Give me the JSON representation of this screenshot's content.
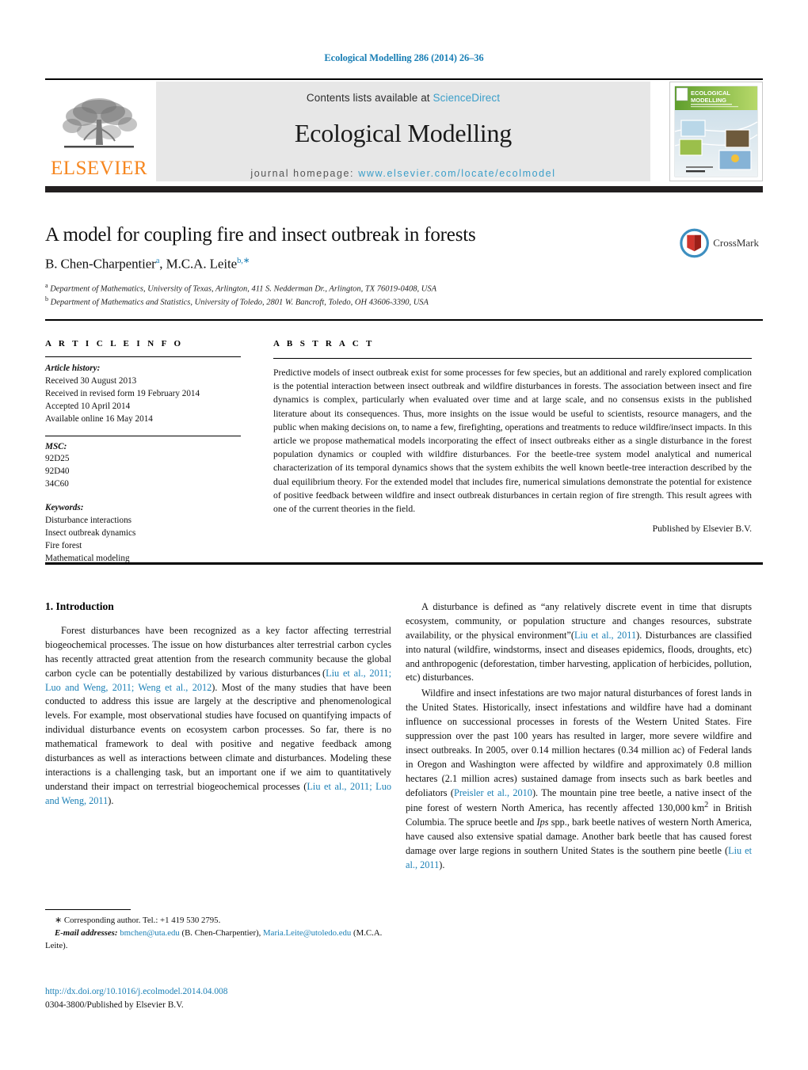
{
  "running_head": "Ecological Modelling 286 (2014) 26–36",
  "header": {
    "contents_prefix": "Contents lists available at ",
    "sciencedirect": "ScienceDirect",
    "journal_title": "Ecological Modelling",
    "homepage_prefix": "journal homepage: ",
    "homepage_url": "www.elsevier.com/locate/ecolmodel",
    "publisher_logo_text": "ELSEVIER",
    "cover_title_line1": "ECOLOGICAL",
    "cover_title_line2": "MODELLING",
    "accent_blue": "#1a7fb5",
    "elsevier_orange": "#F6861F",
    "band_gray": "#e7e7e7"
  },
  "crossmark": {
    "label": "CrossMark"
  },
  "article": {
    "title": "A model for coupling fire and insect outbreak in forests",
    "authors_html": "B. Chen-Charpentier<sup>a</sup>, M.C.A. Leite<sup>b,∗</sup>",
    "affiliation_a": "Department of Mathematics, University of Texas, Arlington, 411 S. Nedderman Dr., Arlington, TX 76019-0408, USA",
    "affiliation_b": "Department of Mathematics and Statistics, University of Toledo, 2801 W. Bancroft, Toledo, OH 43606-3390, USA"
  },
  "info": {
    "heading": "A R T I C L E   I N F O",
    "history_label": "Article history:",
    "history": [
      "Received 30 August 2013",
      "Received in revised form 19 February 2014",
      "Accepted 10 April 2014",
      "Available online 16 May 2014"
    ],
    "msc_label": "MSC:",
    "msc": [
      "92D25",
      "92D40",
      "34C60"
    ],
    "keywords_label": "Keywords:",
    "keywords": [
      "Disturbance interactions",
      "Insect outbreak dynamics",
      "Fire forest",
      "Mathematical modeling"
    ]
  },
  "abstract": {
    "heading": "A B S T R A C T",
    "text": "Predictive models of insect outbreak exist for some processes for few species, but an additional and rarely explored complication is the potential interaction between insect outbreak and wildfire disturbances in forests. The association between insect and fire dynamics is complex, particularly when evaluated over time and at large scale, and no consensus exists in the published literature about its consequences. Thus, more insights on the issue would be useful to scientists, resource managers, and the public when making decisions on, to name a few, firefighting, operations and treatments to reduce wildfire/insect impacts. In this article we propose mathematical models incorporating the effect of insect outbreaks either as a single disturbance in the forest population dynamics or coupled with wildfire disturbances. For the beetle-tree system model analytical and numerical characterization of its temporal dynamics shows that the system exhibits the well known beetle-tree interaction described by the dual equilibrium theory. For the extended model that includes fire, numerical simulations demonstrate the potential for existence of positive feedback between wildfire and insect outbreak disturbances in certain region of fire strength. This result agrees with one of the current theories in the field.",
    "published_by": "Published by Elsevier B.V."
  },
  "body": {
    "section1_title": "1. Introduction",
    "left_para1_html": "Forest disturbances have been recognized as a key factor affecting terrestrial biogeochemical processes. The issue on how disturbances alter terrestrial carbon cycles has recently attracted great attention from the research community because the global carbon cycle can be potentially destabilized by various disturbances&thinsp;(<span class=\"cite\">Liu et al., 2011; Luo and Weng, 2011; Weng et al., 2012</span>). Most of the many studies that have been conducted to address this issue are largely at the descriptive and phenomenological levels. For example, most observational studies have focused on quantifying impacts of individual disturbance events on ecosystem carbon processes. So far, there is no mathematical framework to deal with positive and negative feedback among disturbances as well as interactions between climate and disturbances. Modeling these interactions is a challenging task, but an important one if we aim to quantitatively understand their impact on terrestrial biogeochemical processes (<span class=\"cite\">Liu et al., 2011; Luo and Weng, 2011</span>).",
    "right_para1_html": "A disturbance is defined as “any relatively discrete event in time that disrupts ecosystem, community, or population structure and changes resources, substrate availability, or the physical environment”(<span class=\"cite\">Liu et al., 2011</span>). Disturbances are classified into natural (wildfire, windstorms, insect and diseases epidemics, floods, droughts, etc) and anthropogenic (deforestation, timber harvesting, application of herbicides, pollution, etc) disturbances.",
    "right_para2_html": "Wildfire and insect infestations are two major natural disturbances of forest lands in the United States. Historically, insect infestations and wildfire have had a dominant influence on successional processes in forests of the Western United States. Fire suppression over the past 100 years has resulted in larger, more severe wildfire and insect outbreaks. In 2005, over 0.14 million hectares (0.34 million ac) of Federal lands in Oregon and Washington were affected by wildfire and approximately 0.8 million hectares (2.1 million acres) sustained damage from insects such as bark beetles and defoliators (<span class=\"cite\">Preisler et al., 2010</span>). The mountain pine tree beetle, a native insect of the pine forest of western North America, has recently affected 130,000&thinsp;km<sup>2</sup> in British Columbia. The spruce beetle and <i>Ips</i> spp., bark beetle natives of western North America, have caused also extensive spatial damage. Another bark beetle that has caused forest damage over large regions in southern United States is the southern pine beetle (<span class=\"cite\">Liu et al., 2011</span>)."
  },
  "footnotes": {
    "corresponding_html": "<span style=\"font-size:11px\">∗</span> Corresponding author. Tel.: +1 419 530 2795.",
    "email_label": "E-mail addresses:",
    "email1": "bmchen@uta.edu",
    "email1_owner": "(B. Chen-Charpentier),",
    "email2": "Maria.Leite@utoledo.edu",
    "email2_owner": "(M.C.A. Leite)."
  },
  "footer": {
    "doi": "http://dx.doi.org/10.1016/j.ecolmodel.2014.04.008",
    "issn": "0304-3800/Published by Elsevier B.V."
  }
}
